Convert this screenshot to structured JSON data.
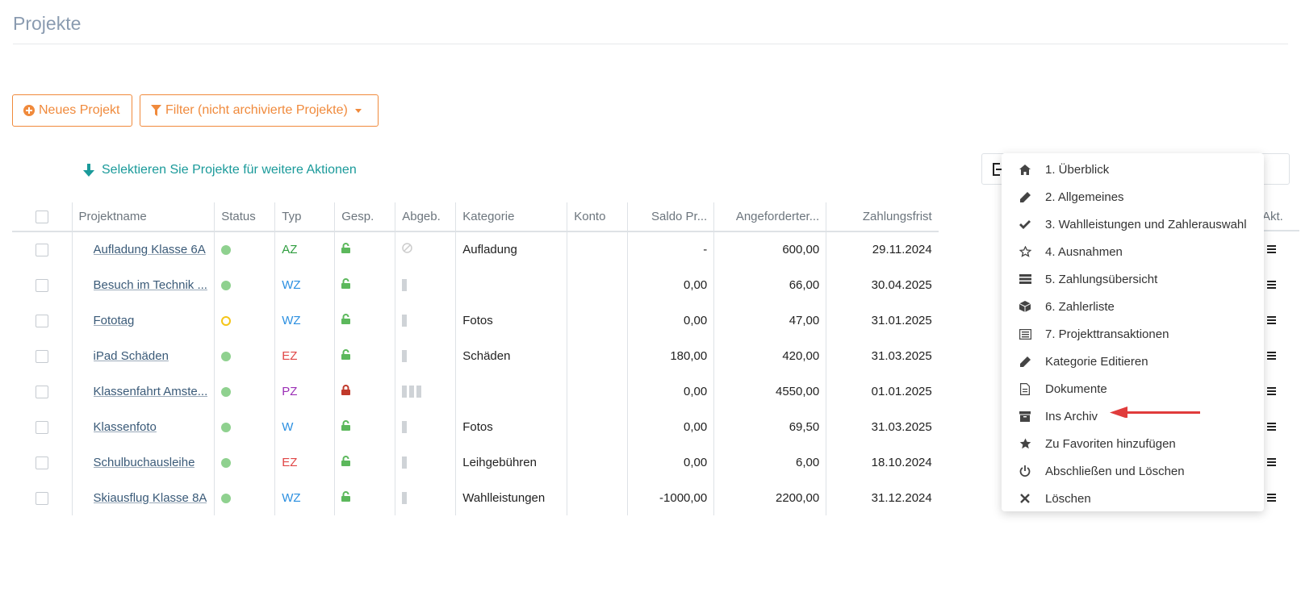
{
  "page": {
    "title": "Projekte"
  },
  "toolbar": {
    "new_project_label": "Neues Projekt",
    "filter_label": "Filter (nicht archivierte Projekte)"
  },
  "hint": {
    "select_text": "Selektieren Sie Projekte für weitere Aktionen"
  },
  "table": {
    "headers": {
      "name": "Projektname",
      "status": "Status",
      "typ": "Typ",
      "gesp": "Gesp.",
      "abgeb": "Abgeb.",
      "kategorie": "Kategorie",
      "konto": "Konto",
      "saldo": "Saldo Pr...",
      "angefordert": "Angeforderter...",
      "frist": "Zahlungsfrist",
      "akt": "Akt."
    },
    "rows": [
      {
        "name": "Aufladung Klasse 6A",
        "status": "active",
        "typ": "AZ",
        "typ_color": "#2e9d3e",
        "locked": false,
        "abgeb": "none",
        "kategorie": "Aufladung",
        "konto": "",
        "saldo": "-",
        "angefordert": "600,00",
        "frist": "29.11.2024"
      },
      {
        "name": "Besuch im Technik ...",
        "status": "active",
        "typ": "WZ",
        "typ_color": "#2b8fe0",
        "locked": false,
        "abgeb": "1",
        "kategorie": "",
        "konto": "",
        "saldo": "0,00",
        "angefordert": "66,00",
        "frist": "30.04.2025"
      },
      {
        "name": "Fototag",
        "status": "inactive",
        "typ": "WZ",
        "typ_color": "#2b8fe0",
        "locked": false,
        "abgeb": "1",
        "kategorie": "Fotos",
        "konto": "",
        "saldo": "0,00",
        "angefordert": "47,00",
        "frist": "31.01.2025"
      },
      {
        "name": "iPad Schäden",
        "status": "active",
        "typ": "EZ",
        "typ_color": "#e04545",
        "locked": false,
        "abgeb": "1",
        "kategorie": "Schäden",
        "konto": "",
        "saldo": "180,00",
        "angefordert": "420,00",
        "frist": "31.03.2025"
      },
      {
        "name": "Klassenfahrt Amste...",
        "status": "active",
        "typ": "PZ",
        "typ_color": "#9b2fb5",
        "locked": true,
        "abgeb": "3",
        "kategorie": "",
        "konto": "",
        "saldo": "0,00",
        "angefordert": "4550,00",
        "frist": "01.01.2025"
      },
      {
        "name": "Klassenfoto",
        "status": "active",
        "typ": "W",
        "typ_color": "#2b8fe0",
        "locked": false,
        "abgeb": "1",
        "kategorie": "Fotos",
        "konto": "",
        "saldo": "0,00",
        "angefordert": "69,50",
        "frist": "31.03.2025"
      },
      {
        "name": "Schulbuchausleihe",
        "status": "active",
        "typ": "EZ",
        "typ_color": "#e04545",
        "locked": false,
        "abgeb": "1",
        "kategorie": "Leihgebühren",
        "konto": "",
        "saldo": "0,00",
        "angefordert": "6,00",
        "frist": "18.10.2024"
      },
      {
        "name": "Skiausflug Klasse 8A",
        "status": "active",
        "typ": "WZ",
        "typ_color": "#2b8fe0",
        "locked": false,
        "abgeb": "1",
        "kategorie": "Wahlleistungen",
        "konto": "",
        "saldo": "-1000,00",
        "angefordert": "2200,00",
        "frist": "31.12.2024"
      }
    ]
  },
  "dropdown": {
    "items": [
      {
        "label": "1. Überblick",
        "icon": "home-icon"
      },
      {
        "label": "2. Allgemeines",
        "icon": "pencil-icon"
      },
      {
        "label": "3. Wahlleistungen und Zahlerauswahl",
        "icon": "check-icon"
      },
      {
        "label": "4. Ausnahmen",
        "icon": "star-outline-icon"
      },
      {
        "label": "5. Zahlungsübersicht",
        "icon": "server-icon"
      },
      {
        "label": "6. Zahlerliste",
        "icon": "cube-icon"
      },
      {
        "label": "7. Projekttransaktionen",
        "icon": "list-alt-icon"
      },
      {
        "label": "Kategorie Editieren",
        "icon": "pencil-icon"
      },
      {
        "label": "Dokumente",
        "icon": "document-icon"
      },
      {
        "label": "Ins Archiv",
        "icon": "archive-icon"
      },
      {
        "label": "Zu Favoriten hinzufügen",
        "icon": "star-icon"
      },
      {
        "label": "Abschließen und Löschen",
        "icon": "power-icon"
      },
      {
        "label": "Löschen",
        "icon": "close-icon"
      }
    ]
  },
  "colors": {
    "accent_orange": "#f08a3c",
    "hint_teal": "#1a9a9a",
    "annotation_arrow": "#e03c3c"
  }
}
